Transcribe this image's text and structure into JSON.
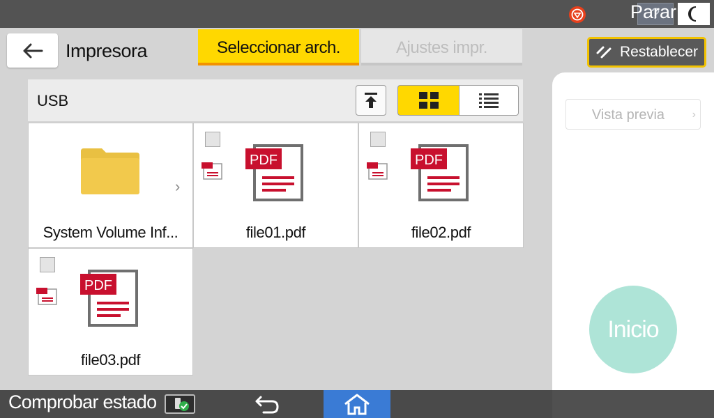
{
  "topbar": {
    "help_label": "?",
    "help_icon": "help-icon",
    "night_icon": "moon-icon"
  },
  "header": {
    "back_icon": "arrow-left-icon",
    "title": "Impresora",
    "tabs": [
      {
        "label": "Seleccionar arch.",
        "active": true
      },
      {
        "label": "Ajustes impr.",
        "active": false
      }
    ],
    "reset_label": "Restablecer",
    "reset_icon": "reset-icon"
  },
  "browser": {
    "location": "USB",
    "up_icon": "upload-top-icon",
    "view_modes": [
      {
        "name": "grid",
        "icon": "grid-view-icon",
        "selected": true
      },
      {
        "name": "list",
        "icon": "list-view-icon",
        "selected": false
      }
    ],
    "items": [
      {
        "type": "folder",
        "name": "System Volume Inf..."
      },
      {
        "type": "pdf",
        "name": "file01.pdf",
        "checked": false
      },
      {
        "type": "pdf",
        "name": "file02.pdf",
        "checked": false
      },
      {
        "type": "pdf",
        "name": "file03.pdf",
        "checked": false
      }
    ],
    "pdf_badge": "PDF"
  },
  "side": {
    "preview_label": "Vista previa",
    "start_label": "Inicio"
  },
  "bottombar": {
    "status_label": "Comprobar estado",
    "status_icon": "usb-ok-icon",
    "back_icon": "undo-icon",
    "home_icon": "home-icon",
    "stop_label": "Parar",
    "stop_icon": "stop-icon"
  },
  "colors": {
    "accent_yellow": "#ffd800",
    "tab_underline": "#f29200",
    "start_button": "#aee4d7",
    "home_blue": "#3a7bd5",
    "pdf_red": "#c8102e"
  }
}
